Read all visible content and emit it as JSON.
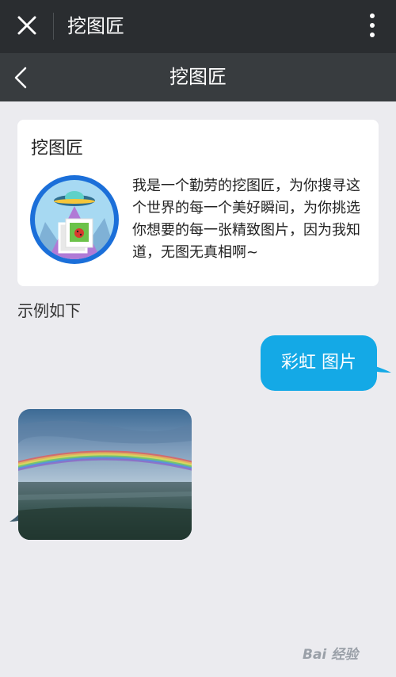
{
  "window": {
    "title": "挖图匠",
    "close_icon": "close-icon",
    "more_icon": "more-vertical-icon"
  },
  "header": {
    "title": "挖图匠",
    "back_icon": "back-chevron-icon"
  },
  "profile_card": {
    "name": "挖图匠",
    "avatar_icon": "ufo-photo-avatar-icon",
    "description": "我是一个勤劳的挖图匠，为你搜寻这个世界的每一个美好瞬间，为你挑选你想要的每一张精致图片，因为我知道，无图无真相啊~"
  },
  "section": {
    "label": "示例如下"
  },
  "messages": [
    {
      "from": "user",
      "type": "text",
      "text": "彩虹 图片"
    },
    {
      "from": "bot",
      "type": "image",
      "image_subject": "rainbow-landscape-photo"
    }
  ],
  "watermark": {
    "text": "Bai 经验"
  },
  "colors": {
    "topbar_bg": "#2a2d30",
    "subbar_bg": "#383c3f",
    "page_bg": "#ebebef",
    "user_bubble": "#14a9e6"
  }
}
